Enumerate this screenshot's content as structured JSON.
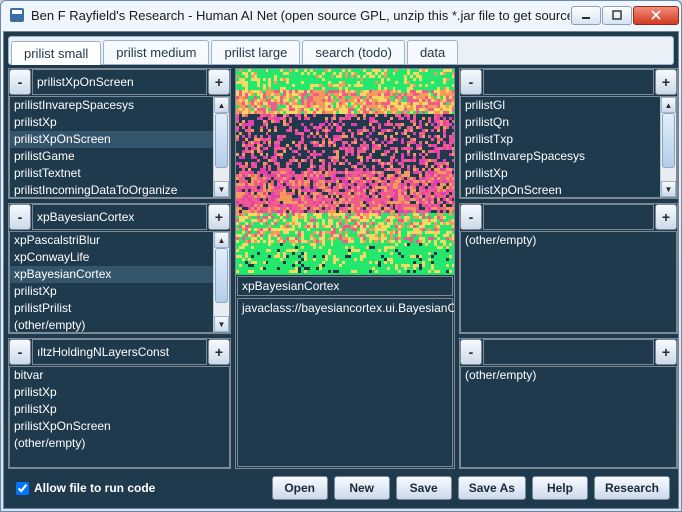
{
  "window": {
    "title": "Ben F Rayfield's Research - Human AI Net (open source GPL, unzip this *.jar file to get source)"
  },
  "tabs": [
    {
      "label": "prilist small",
      "active": true
    },
    {
      "label": "prilist medium",
      "active": false
    },
    {
      "label": "prilist large",
      "active": false
    },
    {
      "label": "search (todo)",
      "active": false
    },
    {
      "label": "data",
      "active": false
    }
  ],
  "panels": {
    "left_top": {
      "name_value": "prilistXpOnScreen",
      "items": [
        "prilistInvarepSpacesys",
        "prilistXp",
        "prilistXpOnScreen",
        "prilistGame",
        "prilistTextnet",
        "prilistIncomingDataToOrganize"
      ],
      "selected_index": 2
    },
    "left_mid": {
      "name_value": "xpBayesianCortex",
      "items": [
        "xpPascalstriBlur",
        "xpConwayLife",
        "xpBayesianCortex",
        "prilistXp",
        "prilistPrilist",
        "(other/empty)"
      ],
      "selected_index": 2
    },
    "left_bot": {
      "name_value": "ıltzHoldingNLayersConst",
      "items": [
        "bitvar",
        "prilistXp",
        "prilistXp",
        "prilistXpOnScreen",
        "(other/empty)"
      ],
      "selected_index": -1
    },
    "center": {
      "label": "xpBayesianCortex",
      "classpath": "javaclass://bayesiancortex.ui.BayesianCortexDynarect"
    },
    "right_top": {
      "name_value": "",
      "items": [
        "prilistGl",
        "prilistQn",
        "prilistTxp",
        "prilistInvarepSpacesys",
        "prilistXp",
        "prilistXpOnScreen"
      ],
      "selected_index": -1
    },
    "right_mid": {
      "name_value": "",
      "items": [
        "(other/empty)"
      ],
      "selected_index": -1
    },
    "right_bot": {
      "name_value": "",
      "items": [
        "(other/empty)"
      ],
      "selected_index": -1
    }
  },
  "bottom": {
    "allow_file_label": "Allow file to run code",
    "allow_file_checked": true,
    "buttons": [
      "Open",
      "New",
      "Save",
      "Save As",
      "Help",
      "Research"
    ]
  },
  "btn_labels": {
    "minus": "-",
    "plus": "+"
  },
  "viz_colors": {
    "green": "#24e86d",
    "yellow": "#f3d861",
    "orange": "#f59a5d",
    "pink": "#ef5e8a",
    "magenta": "#e33fb1",
    "navy": "#1f3a4d"
  }
}
